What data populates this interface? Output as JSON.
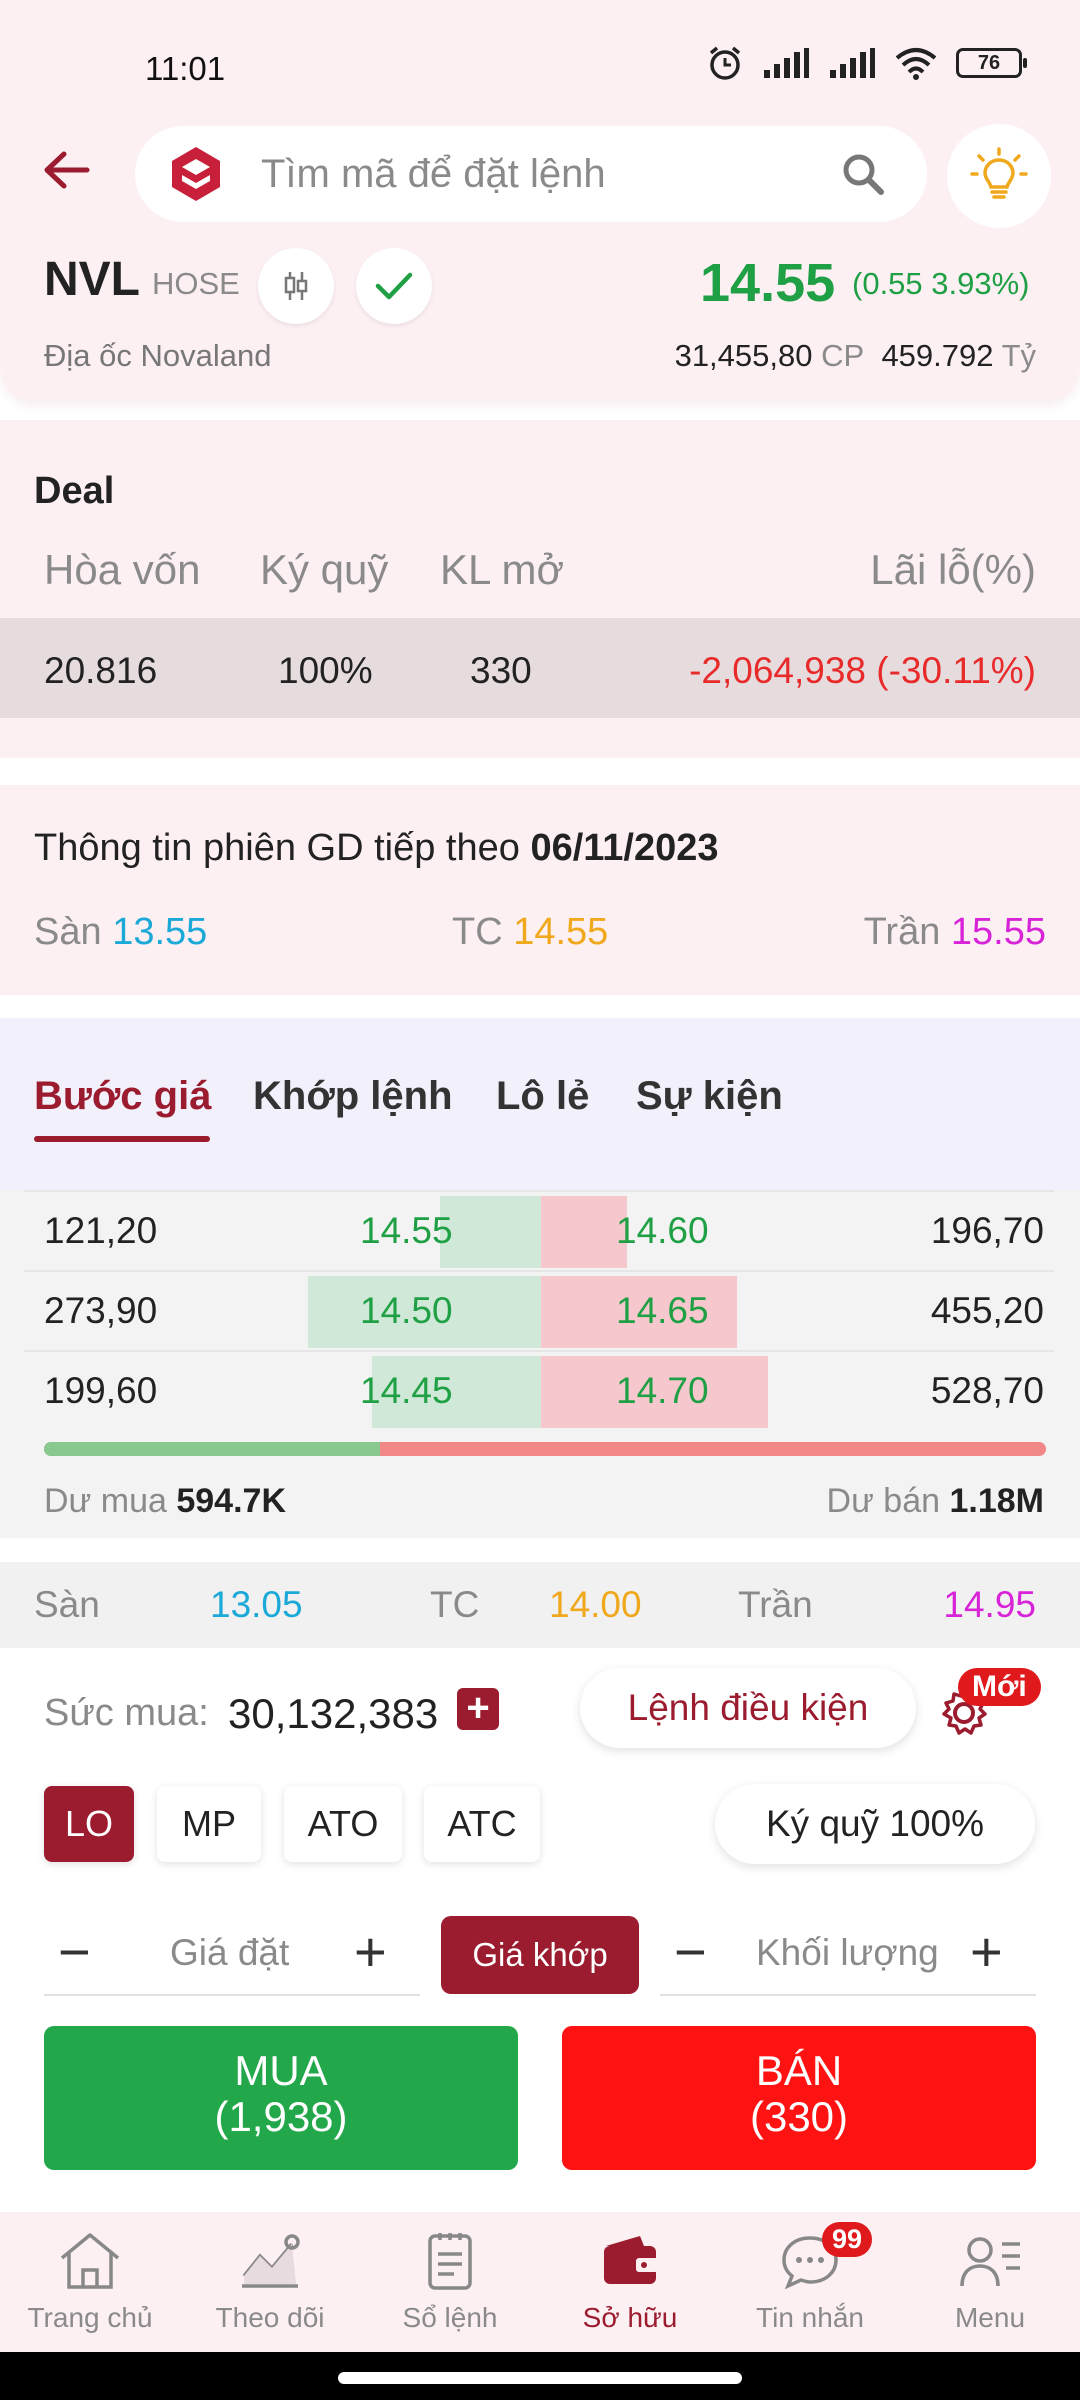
{
  "status_bar": {
    "time": "11:01",
    "battery": "76"
  },
  "header": {
    "search_placeholder": "Tìm mã để đặt lệnh",
    "symbol": "NVL",
    "exchange": "HOSE",
    "price": "14.55",
    "change": "(0.55 3.93%)",
    "company": "Địa ốc Novaland",
    "volume": "31,455,80",
    "volume_unit": "CP",
    "value": "459.792",
    "value_unit": "Tỷ",
    "colors": {
      "up": "#1fa045",
      "brand": "#9b1c2e"
    }
  },
  "deal": {
    "title": "Deal",
    "headers": [
      "Hòa vốn",
      "Ký quỹ",
      "KL mở",
      "Lãi lỗ(%)"
    ],
    "values": [
      "20.816",
      "100%",
      "330",
      "-2,064,938 (-30.11%)"
    ]
  },
  "session": {
    "title_prefix": "Thông tin phiên GD tiếp theo",
    "date": "06/11/2023",
    "floor_label": "Sàn",
    "floor": "13.55",
    "ref_label": "TC",
    "ref": "14.55",
    "ceil_label": "Trần",
    "ceil": "15.55"
  },
  "tabs": [
    "Bước giá",
    "Khớp lệnh",
    "Lô lẻ",
    "Sự kiện"
  ],
  "order_book": {
    "rows": [
      {
        "bid_vol": "121,20",
        "bid_price": "14.55",
        "ask_price": "14.60",
        "ask_vol": "196,70",
        "bid_fill": 0.33,
        "ask_fill": 0.28
      },
      {
        "bid_vol": "273,90",
        "bid_price": "14.50",
        "ask_price": "14.65",
        "ask_vol": "455,20",
        "bid_fill": 0.76,
        "ask_fill": 0.64
      },
      {
        "bid_vol": "199,60",
        "bid_price": "14.45",
        "ask_price": "14.70",
        "ask_vol": "528,70",
        "bid_fill": 0.55,
        "ask_fill": 0.74
      }
    ],
    "bid_ratio": 0.335,
    "resid_buy_label": "Dư mua",
    "resid_buy": "594.7K",
    "resid_sell_label": "Dư bán",
    "resid_sell": "1.18M"
  },
  "price_strip": {
    "floor_label": "Sàn",
    "floor": "13.05",
    "ref_label": "TC",
    "ref": "14.00",
    "ceil_label": "Trần",
    "ceil": "14.95"
  },
  "order_panel": {
    "power_label": "Sức mua:",
    "power_value": "30,132,383",
    "plus": "+",
    "conditional_label": "Lệnh điều kiện",
    "new_badge": "Mới",
    "order_types": [
      "LO",
      "MP",
      "ATO",
      "ATC"
    ],
    "margin_label": "Ký quỹ 100%",
    "minus": "−",
    "price_placeholder": "Giá đặt",
    "match_label": "Giá khớp",
    "qty_placeholder": "Khối lượng",
    "buy_label": "MUA",
    "buy_qty": "(1,938)",
    "sell_label": "BÁN",
    "sell_qty": "(330)"
  },
  "nav": {
    "items": [
      "Trang chủ",
      "Theo dõi",
      "Sổ lệnh",
      "Sở hữu",
      "Tin nhắn",
      "Menu"
    ],
    "message_badge": "99"
  }
}
